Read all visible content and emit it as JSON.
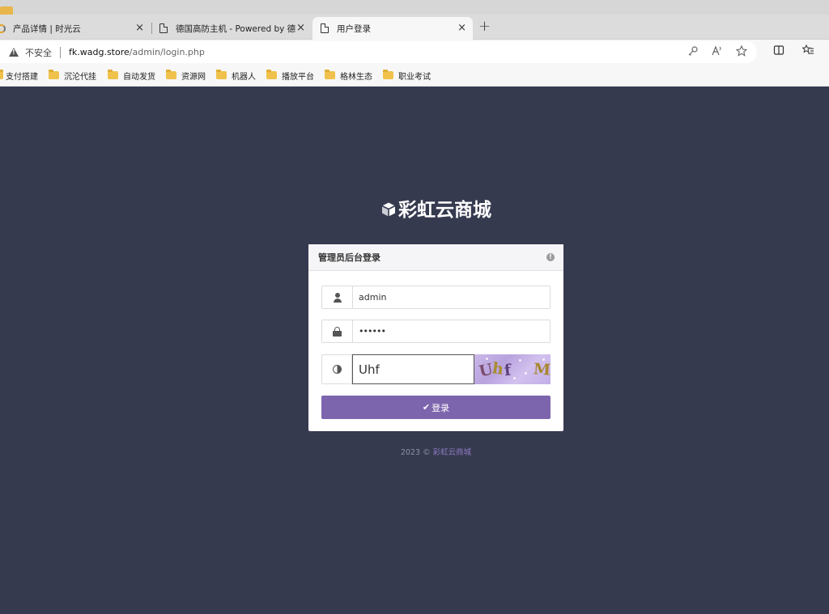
{
  "browser": {
    "tabs": [
      {
        "label": "产品详情 | 时光云"
      },
      {
        "label": "德国高防主机 - Powered by 德国"
      },
      {
        "label": "用户登录"
      }
    ],
    "newtab_symbol": "+",
    "close_symbol": "×",
    "address": {
      "security_text": "不安全",
      "url_host": "fk.wadg.store",
      "url_path": "/admin/login.php"
    },
    "bookmarks": [
      {
        "label": "支付搭建"
      },
      {
        "label": "沉沦代挂"
      },
      {
        "label": "自动发货"
      },
      {
        "label": "资源网"
      },
      {
        "label": "机器人"
      },
      {
        "label": "播放平台"
      },
      {
        "label": "格林生态"
      },
      {
        "label": "职业考试"
      }
    ]
  },
  "page": {
    "brand_title": "彩虹云商城",
    "panel_title": "管理员后台登录",
    "form": {
      "username_value": "admin",
      "password_value": "••••••",
      "captcha_value": "Uhf",
      "captcha_image_text": "UhfM",
      "submit_label": "登录"
    },
    "footer": {
      "prefix": "2023 © ",
      "link": "彩虹云商城"
    }
  },
  "colors": {
    "page_background": "#363a4f",
    "accent": "#7d65ad",
    "footer_link": "#8f7bc4"
  },
  "icons": {
    "brand": "cube-icon",
    "username": "user-icon",
    "password": "lock-icon",
    "captcha": "contrast-icon",
    "submit": "check-icon",
    "panel_info": "info-icon"
  }
}
